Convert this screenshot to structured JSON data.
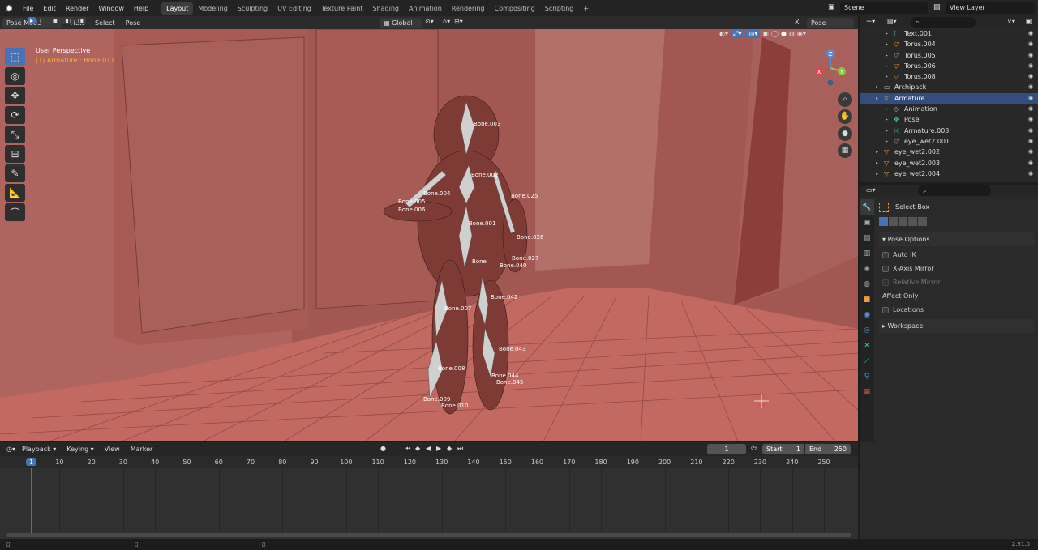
{
  "menu": {
    "items": [
      "File",
      "Edit",
      "Render",
      "Window",
      "Help"
    ],
    "workspaces": [
      "Layout",
      "Modeling",
      "Sculpting",
      "UV Editing",
      "Texture Paint",
      "Shading",
      "Animation",
      "Rendering",
      "Compositing",
      "Scripting"
    ],
    "active_workspace": "Layout",
    "add_tab": "+",
    "scene": "Scene",
    "view_layer": "View Layer"
  },
  "viewport": {
    "mode": "Pose Mode",
    "menus": [
      "View",
      "Select",
      "Pose"
    ],
    "orientation": "Global",
    "pose_options": "Pose Options",
    "close_x": "X",
    "perspective_label": "User Perspective",
    "active_object": "(1) Armature : Bone.011",
    "gizmo_x": "X",
    "gizmo_y": "Y",
    "gizmo_z": "Z",
    "bones": [
      "Bone.003",
      "Bone.002",
      "Bone.004",
      "Bone.025",
      "Bone.005",
      "Bone.006",
      "Bone.001",
      "Bone.026",
      "Bone",
      "Bone.027",
      "Bone.040",
      "Bone.042",
      "Bone.007",
      "Bone.043",
      "Bone.008",
      "Bone.044",
      "Bone.045",
      "Bone.009",
      "Bone.010"
    ]
  },
  "outliner": {
    "items": [
      {
        "label": "Text.001",
        "indent": 2,
        "icon": "text"
      },
      {
        "label": "Torus.004",
        "indent": 2,
        "icon": "mesh"
      },
      {
        "label": "Torus.005",
        "indent": 2,
        "icon": "mesh"
      },
      {
        "label": "Torus.006",
        "indent": 2,
        "icon": "mesh"
      },
      {
        "label": "Torus.008",
        "indent": 2,
        "icon": "mesh"
      },
      {
        "label": "Archipack",
        "indent": 1,
        "icon": "collection"
      },
      {
        "label": "Armature",
        "indent": 1,
        "icon": "armature",
        "selected": true
      },
      {
        "label": "Animation",
        "indent": 2,
        "icon": "action"
      },
      {
        "label": "Pose",
        "indent": 2,
        "icon": "pose"
      },
      {
        "label": "Armature.003",
        "indent": 2,
        "icon": "armature-data"
      },
      {
        "label": "eye_wet2.001",
        "indent": 2,
        "icon": "mesh"
      },
      {
        "label": "eye_wet2.002",
        "indent": 1,
        "icon": "mesh"
      },
      {
        "label": "eye_wet2.003",
        "indent": 1,
        "icon": "mesh"
      },
      {
        "label": "eye_wet2.004",
        "indent": 1,
        "icon": "mesh"
      }
    ]
  },
  "properties": {
    "tool_name": "Select Box",
    "pose_options_header": "Pose Options",
    "auto_ik": "Auto IK",
    "x_axis_mirror": "X-Axis Mirror",
    "relative_mirror": "Relative Mirror",
    "affect_only": "Affect Only",
    "locations": "Locations",
    "workspace": "Workspace"
  },
  "timeline": {
    "menus": [
      "Playback",
      "Keying",
      "View",
      "Marker"
    ],
    "current_frame": "1",
    "start_label": "Start",
    "start": "1",
    "end_label": "End",
    "end": "250",
    "ticks": [
      "1",
      "10",
      "20",
      "30",
      "40",
      "50",
      "60",
      "70",
      "80",
      "90",
      "100",
      "110",
      "120",
      "130",
      "140",
      "150",
      "160",
      "170",
      "180",
      "190",
      "200",
      "210",
      "220",
      "230",
      "240",
      "250"
    ]
  },
  "status": {
    "version": "2.91.0"
  },
  "colors": {
    "accent": "#4772b3",
    "selection_row": "#334d80",
    "mesh_icon": "#e8a03a",
    "data_icon": "#46c8a0",
    "viewport_wall": "#a85a55"
  }
}
